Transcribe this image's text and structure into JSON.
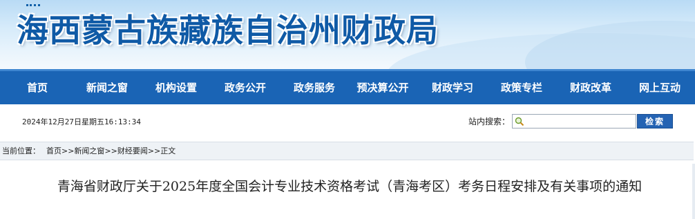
{
  "header": {
    "site_title": "海西蒙古族藏族自治州财政局",
    "logo_icon": "emblem-icon"
  },
  "nav": {
    "items": [
      {
        "label": "首页"
      },
      {
        "label": "新闻之窗"
      },
      {
        "label": "机构设置"
      },
      {
        "label": "政务公开"
      },
      {
        "label": "政务服务"
      },
      {
        "label": "预决算公开"
      },
      {
        "label": "财政学习"
      },
      {
        "label": "政策专栏"
      },
      {
        "label": "财政改革"
      },
      {
        "label": "网上互动"
      }
    ]
  },
  "info_bar": {
    "datetime": "2024年12月27日星期五16:13:34",
    "search_label": "站内搜索：",
    "search_placeholder": "",
    "search_button": "检索"
  },
  "breadcrumb": {
    "label": "当前位置：",
    "items": [
      "首页",
      "新闻之窗",
      "财经要闻",
      "正文"
    ],
    "separator": ">>"
  },
  "article": {
    "title": "青海省财政厅关于2025年度全国会计专业技术资格考试（青海考区）考务日程安排及有关事项的通知"
  },
  "colors": {
    "nav_bg": "#1a64b5",
    "title_blue": "#0f5aa6",
    "button_bg": "#2463b3"
  }
}
